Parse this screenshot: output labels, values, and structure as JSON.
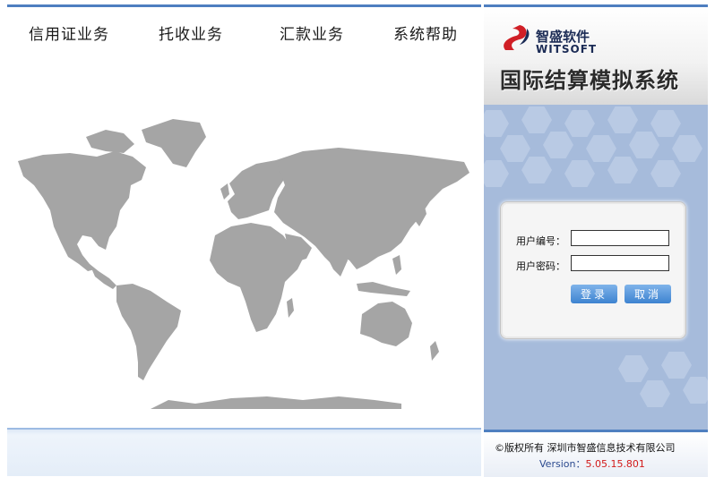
{
  "nav": {
    "items": [
      "信用证业务",
      "托收业务",
      "汇款业务",
      "系统帮助"
    ]
  },
  "brand": {
    "logo_cn": "智盛软件",
    "logo_en": "WITSOFT",
    "system_title": "国际结算模拟系统"
  },
  "login": {
    "user_label": "用户编号：",
    "password_label": "用户密码：",
    "user_value": "",
    "password_value": "",
    "login_button": "登录",
    "cancel_button": "取消"
  },
  "footer": {
    "copyright": "©版权所有  深圳市智盛信息技术有限公司",
    "version_label": "Version：",
    "version_value": "5.05.15.801"
  },
  "colors": {
    "accent": "#4e7fc0",
    "map_land": "#a5a5a5",
    "panel_bg": "#a6bbdb",
    "version_value": "#d21a1a"
  }
}
